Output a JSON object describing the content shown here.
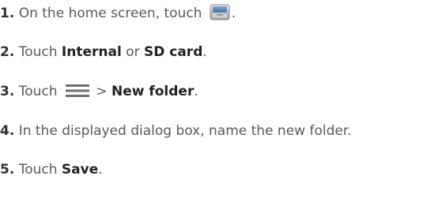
{
  "steps": [
    {
      "number": "1.",
      "text_before": "On the home screen, touch",
      "icon": "file-manager-folder-icon",
      "text_after": "."
    },
    {
      "number": "2.",
      "text_before": "Touch",
      "bold_1": "Internal",
      "middle": "or",
      "bold_2": "SD card",
      "text_after": "."
    },
    {
      "number": "3.",
      "text_before": "Touch",
      "icon": "menu-icon",
      "separator": ">",
      "bold": "New folder",
      "text_after": "."
    },
    {
      "number": "4.",
      "text": "In the displayed dialog box, name the new folder."
    },
    {
      "number": "5.",
      "text_before": "Touch",
      "bold": "Save",
      "text_after": "."
    }
  ],
  "colors": {
    "text": "#595959",
    "bold_text": "#222222",
    "menu_icon": "#6f6f6f",
    "folder_icon_body": "#b9b9b9"
  }
}
